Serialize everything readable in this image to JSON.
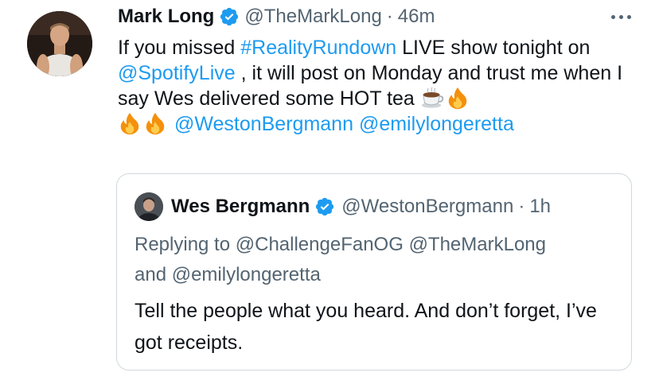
{
  "tweet": {
    "author_name": "Mark Long",
    "author_handle": "@TheMarkLong",
    "separator": "·",
    "time": "46m",
    "text_part1": "If you missed ",
    "hashtag": "#RealityRundown",
    "text_part2": " LIVE show tonight on ",
    "mention_spotify": "@SpotifyLive",
    "text_part3": " , it will post on Monday and trust me when I say Wes delivered some HOT tea ",
    "emojis": [
      "teacup-icon",
      "fire-icon",
      "fire-icon",
      "fire-icon"
    ],
    "mention_weston": "@WestonBergmann",
    "mention_emily": "@emilylongeretta"
  },
  "quote": {
    "author_name": "Wes Bergmann",
    "author_handle": "@WestonBergmann",
    "separator": "·",
    "time": "1h",
    "replying_prefix": "Replying to ",
    "reply_mention_1": "@ChallengeFanOG",
    "reply_mention_2": "@TheMarkLong",
    "reply_and": "and ",
    "reply_mention_3": "@emilylongeretta",
    "text": "Tell the people what you heard. And don’t forget, I’ve got receipts."
  },
  "colors": {
    "link": "#1d9bf0",
    "secondary": "#536471",
    "text": "#0f1419",
    "verified": "#1d9bf0",
    "border": "#cfd9de"
  }
}
